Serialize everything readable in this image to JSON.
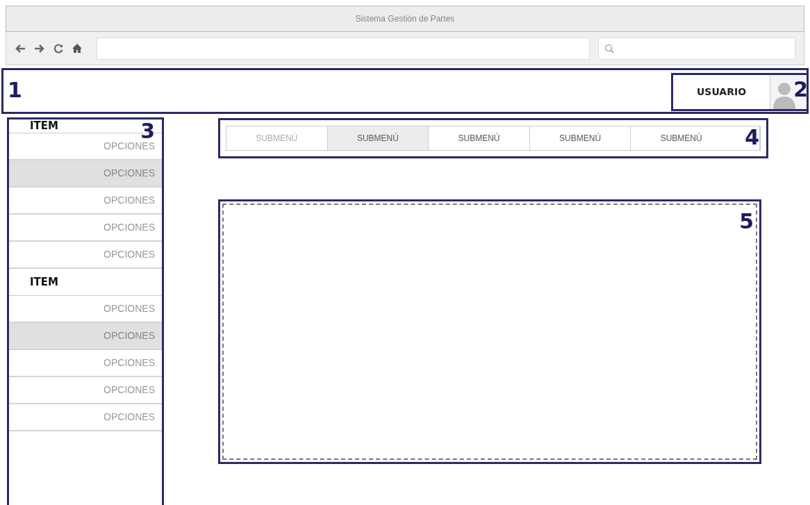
{
  "window": {
    "title": "Sistema Gestión de Partes"
  },
  "header": {
    "user_label": "USUARIO"
  },
  "sidebar": {
    "groups": [
      {
        "label": "ITEM",
        "items": [
          {
            "label": "OPCIONES",
            "selected": false
          },
          {
            "label": "OPCIONES",
            "selected": true
          },
          {
            "label": "OPCIONES",
            "selected": false
          },
          {
            "label": "OPCIONES",
            "selected": false
          },
          {
            "label": "OPCIONES",
            "selected": false
          }
        ]
      },
      {
        "label": "ITEM",
        "items": [
          {
            "label": "OPCIONES",
            "selected": false
          },
          {
            "label": "OPCIONES",
            "selected": true
          },
          {
            "label": "OPCIONES",
            "selected": false
          },
          {
            "label": "OPCIONES",
            "selected": false
          },
          {
            "label": "OPCIONES",
            "selected": false
          }
        ]
      }
    ]
  },
  "submenu": [
    {
      "label": "SUBMENÚ",
      "selected": false,
      "disabled": true
    },
    {
      "label": "SUBMENÚ",
      "selected": true,
      "disabled": false
    },
    {
      "label": "SUBMENÚ",
      "selected": false,
      "disabled": false
    },
    {
      "label": "SUBMENÚ",
      "selected": false,
      "disabled": false
    },
    {
      "label": "SUBMENÚ",
      "selected": false,
      "disabled": false
    }
  ],
  "annotations": [
    "1",
    "2",
    "3",
    "4",
    "5"
  ]
}
